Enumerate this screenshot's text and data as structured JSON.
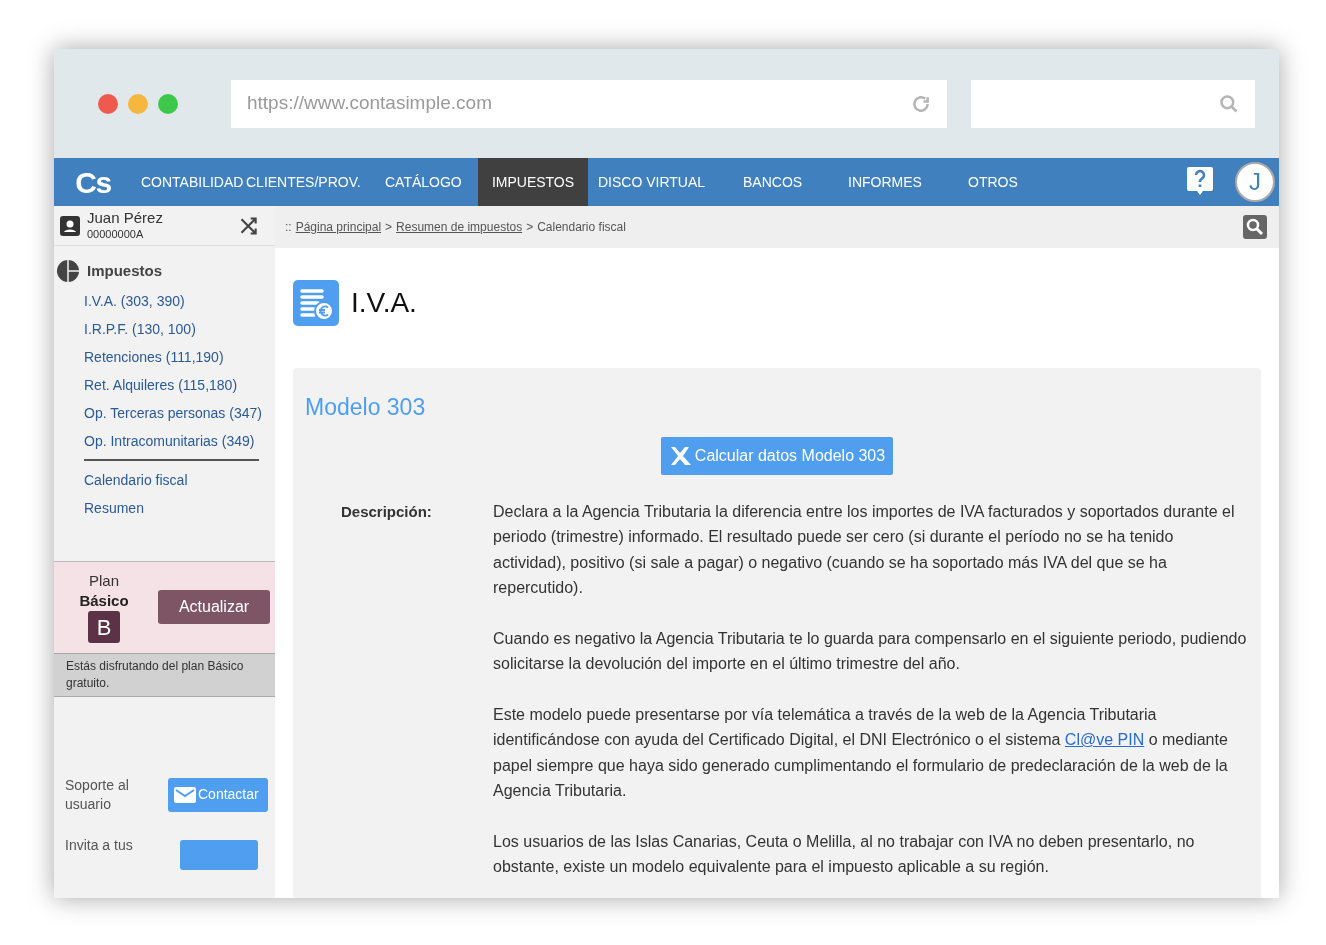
{
  "browser": {
    "url": "https://www.contasimple.com"
  },
  "nav": {
    "logo": "Cs",
    "items": [
      {
        "label": "CONTABILIDAD",
        "selected": false
      },
      {
        "label": "CLIENTES/PROV.",
        "selected": false
      },
      {
        "label": "CATÁLOGO",
        "selected": false
      },
      {
        "label": "IMPUESTOS",
        "selected": true
      },
      {
        "label": "DISCO VIRTUAL",
        "selected": false
      },
      {
        "label": "BANCOS",
        "selected": false
      },
      {
        "label": "INFORMES",
        "selected": false
      },
      {
        "label": "OTROS",
        "selected": false
      }
    ],
    "avatar": "J"
  },
  "user": {
    "name": "Juan Pérez",
    "id": "00000000A"
  },
  "breadcrumb": {
    "prefix": "::",
    "links": [
      "Página principal",
      "Resumen de impuestos"
    ],
    "current": "Calendario fiscal",
    "separator": ">"
  },
  "sidebar": {
    "title": "Impuestos",
    "items": [
      "I.V.A. (303, 390)",
      "I.R.P.F. (130, 100)",
      "Retenciones (111,190)",
      "Ret. Alquileres (115,180)",
      "Op. Terceras personas (347)",
      "Op. Intracomunitarias (349)"
    ],
    "extra_items": [
      "Calendario fiscal",
      "Resumen"
    ]
  },
  "plan": {
    "label": "Plan",
    "name": "Básico",
    "badge": "B",
    "button": "Actualizar",
    "notice": "Estás disfrutando del plan Básico gratuito."
  },
  "support": {
    "label": "Soporte al usuario",
    "button": "Contactar"
  },
  "invite": {
    "label": "Invita a tus"
  },
  "page": {
    "title": "I.V.A."
  },
  "card": {
    "title": "Modelo 303",
    "button": "Calcular datos Modelo 303",
    "description_label": "Descripción:",
    "paragraphs": [
      {
        "text": "Declara a la Agencia Tributaria la diferencia entre los importes de IVA facturados y soportados durante el periodo (trimestre) informado. El resultado puede ser cero (si durante el período no se ha tenido actividad), positivo (si sale a pagar) o negativo (cuando se ha soportado más IVA del que se ha repercutido)."
      },
      {
        "text": "Cuando es negativo la Agencia Tributaria te lo guarda para compensarlo en el siguiente periodo, pudiendo solicitarse la devolución del importe en el último trimestre del año."
      },
      {
        "text": "Este modelo puede presentarse por vía telemática a través de la web de la Agencia Tributaria identificándose con ayuda del Certificado Digital, el DNI Electrónico o el sistema",
        "link": "Cl@ve PIN",
        "after": "o mediante papel siempre que haya sido generado cumplimentando el formulario de predeclaración de la web de la Agencia Tributaria."
      },
      {
        "text": "Los usuarios de las Islas Canarias, Ceuta o Melilla, al no trabajar con IVA no deben presentarlo, no obstante, existe un modelo equivalente para el impuesto aplicable a su región."
      }
    ]
  }
}
